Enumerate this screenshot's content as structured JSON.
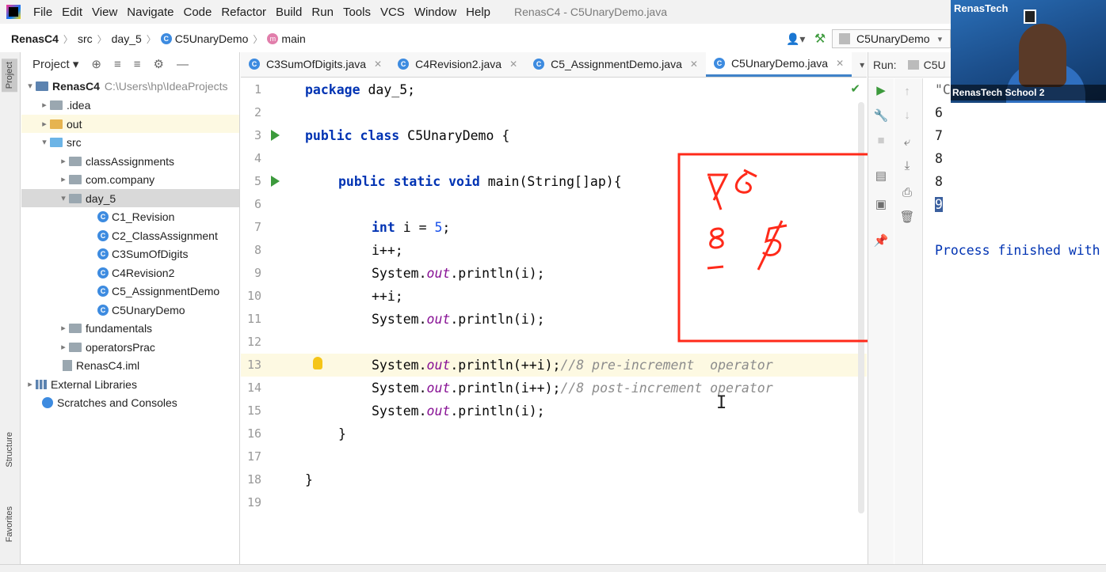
{
  "menubar": {
    "items": [
      "File",
      "Edit",
      "View",
      "Navigate",
      "Code",
      "Refactor",
      "Build",
      "Run",
      "Tools",
      "VCS",
      "Window",
      "Help"
    ],
    "title": "RenasC4 - C5UnaryDemo.java"
  },
  "navbar": {
    "breadcrumbs": [
      "RenasC4",
      "src",
      "day_5",
      "C5UnaryDemo",
      "main"
    ],
    "run_config": "C5UnaryDemo"
  },
  "left_stripe": {
    "project": "Project",
    "structure": "Structure",
    "favorites": "Favorites"
  },
  "project_panel": {
    "title": "Project",
    "tree": [
      {
        "label": "RenasC4",
        "path": "C:\\Users\\hp\\IdeaProjects"
      },
      {
        "label": ".idea"
      },
      {
        "label": "out"
      },
      {
        "label": "src"
      },
      {
        "label": "classAssignments"
      },
      {
        "label": "com.company"
      },
      {
        "label": "day_5"
      },
      {
        "label": "C1_Revision"
      },
      {
        "label": "C2_ClassAssignment"
      },
      {
        "label": "C3SumOfDigits"
      },
      {
        "label": "C4Revision2"
      },
      {
        "label": "C5_AssignmentDemo"
      },
      {
        "label": "C5UnaryDemo"
      },
      {
        "label": "fundamentals"
      },
      {
        "label": "operatorsPrac"
      },
      {
        "label": "RenasC4.iml"
      },
      {
        "label": "External Libraries"
      },
      {
        "label": "Scratches and Consoles"
      }
    ]
  },
  "editor": {
    "tabs": [
      "C3SumOfDigits.java",
      "C4Revision2.java",
      "C5_AssignmentDemo.java",
      "C5UnaryDemo.java"
    ],
    "active_tab": "C5UnaryDemo.java",
    "line_numbers": [
      "1",
      "2",
      "3",
      "4",
      "5",
      "6",
      "7",
      "8",
      "9",
      "10",
      "11",
      "12",
      "13",
      "14",
      "15",
      "16",
      "17",
      "18",
      "19"
    ],
    "code": {
      "l1_kw": "package",
      "l1_rest": " day_5;",
      "l3_kw": "public class",
      "l3_rest": " C5UnaryDemo {",
      "l5_kw": "public static void",
      "l5_rest": " main(String[]ap){",
      "l7_kw": "int",
      "l7_rest": " i = ",
      "l7_num": "5",
      "l7_end": ";",
      "l8": "i++;",
      "sys": "System.",
      "out": "out",
      "println_i": ".println(i);",
      "l10": "++i;",
      "println_pre": ".println(++i);",
      "comment_pre": "//8 pre-increment  operator",
      "println_post": ".println(i++);",
      "comment_post": "//8 post-increment operator",
      "l16": "}",
      "l18": "}"
    }
  },
  "annotation": {
    "scribble_text": [
      "7",
      "6",
      "8",
      "5",
      "1"
    ],
    "color": "#ff2a1a"
  },
  "run_panel": {
    "label": "Run:",
    "tab": "C5U",
    "output": [
      "\"C",
      "6",
      "7",
      "8",
      "8",
      "9"
    ],
    "process": "Process finished with"
  },
  "webcam": {
    "brand": "RenasTech",
    "label": "RenasTech School 2"
  },
  "colors": {
    "keyword": "#0033b3",
    "number": "#1750eb",
    "field": "#871094",
    "comment": "#8c8c8c",
    "active_tab": "#4083c9"
  }
}
